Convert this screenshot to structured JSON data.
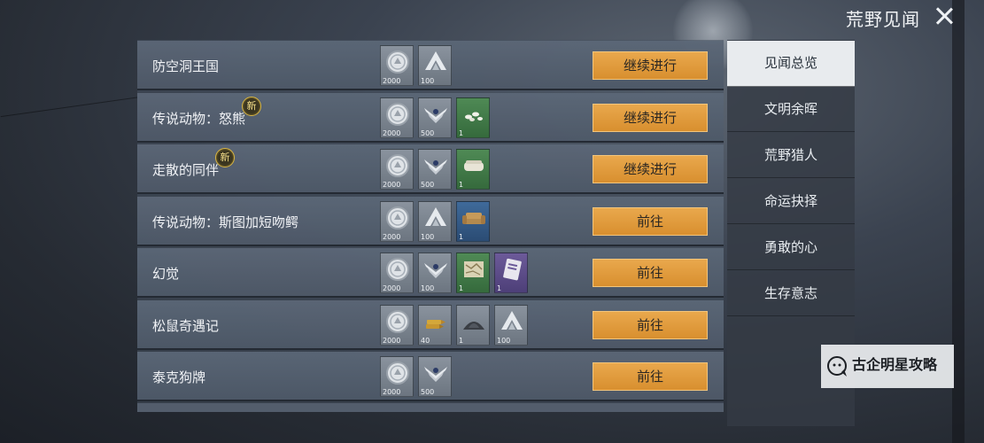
{
  "window": {
    "title": "荒野见闻"
  },
  "rows": [
    {
      "name": "防空洞王国",
      "new": false,
      "action": "继续进行",
      "rewards": [
        {
          "icon": "silver-coin-icon",
          "bg": "gray",
          "count": "2000"
        },
        {
          "icon": "rank-chevron-icon",
          "bg": "gray",
          "count": "100"
        }
      ]
    },
    {
      "name": "传说动物：怒熊",
      "new": true,
      "new_label": "新",
      "action": "继续进行",
      "rewards": [
        {
          "icon": "silver-coin-icon",
          "bg": "gray",
          "count": "2000"
        },
        {
          "icon": "winged-badge-icon",
          "bg": "gray",
          "count": "500"
        },
        {
          "icon": "mushroom-cluster-icon",
          "bg": "green",
          "count": "1"
        }
      ]
    },
    {
      "name": "走散的同伴",
      "new": true,
      "new_label": "新",
      "action": "继续进行",
      "rewards": [
        {
          "icon": "silver-coin-icon",
          "bg": "gray",
          "count": "2000"
        },
        {
          "icon": "winged-badge-icon",
          "bg": "gray",
          "count": "500"
        },
        {
          "icon": "bedroll-icon",
          "bg": "green",
          "count": "1"
        }
      ]
    },
    {
      "name": "传说动物：斯图加短吻鳄",
      "new": false,
      "action": "前往",
      "rewards": [
        {
          "icon": "silver-coin-icon",
          "bg": "gray",
          "count": "2000"
        },
        {
          "icon": "rank-chevron-icon",
          "bg": "gray",
          "count": "100"
        },
        {
          "icon": "sofa-icon",
          "bg": "blue",
          "count": "1"
        }
      ]
    },
    {
      "name": "幻觉",
      "new": false,
      "action": "前往",
      "rewards": [
        {
          "icon": "silver-coin-icon",
          "bg": "gray",
          "count": "2000"
        },
        {
          "icon": "winged-badge-icon",
          "bg": "gray",
          "count": "100"
        },
        {
          "icon": "map-icon",
          "bg": "green",
          "count": "1"
        },
        {
          "icon": "card-icon",
          "bg": "purple",
          "count": "1"
        }
      ]
    },
    {
      "name": "松鼠奇遇记",
      "new": false,
      "action": "前往",
      "rewards": [
        {
          "icon": "silver-coin-icon",
          "bg": "gray",
          "count": "2000"
        },
        {
          "icon": "ammo-icon",
          "bg": "gray",
          "count": "40"
        },
        {
          "icon": "gunpowder-icon",
          "bg": "gray",
          "count": "1"
        },
        {
          "icon": "rank-chevron-icon",
          "bg": "gray",
          "count": "100"
        }
      ]
    },
    {
      "name": "泰克狗牌",
      "new": false,
      "action": "前往",
      "rewards": [
        {
          "icon": "silver-coin-icon",
          "bg": "gray",
          "count": "2000"
        },
        {
          "icon": "winged-badge-icon",
          "bg": "gray",
          "count": "500"
        }
      ]
    }
  ],
  "sidebar": {
    "items": [
      {
        "label": "见闻总览",
        "active": true
      },
      {
        "label": "文明余晖",
        "active": false
      },
      {
        "label": "荒野猎人",
        "active": false
      },
      {
        "label": "命运抉择",
        "active": false
      },
      {
        "label": "勇敢的心",
        "active": false
      },
      {
        "label": "生存意志",
        "active": false
      }
    ]
  },
  "watermark": {
    "text": "古企明星攻略"
  },
  "colors": {
    "action_button": "#e39d40",
    "active_tab_bg": "#e8ebee",
    "new_badge": "#d6b445"
  }
}
